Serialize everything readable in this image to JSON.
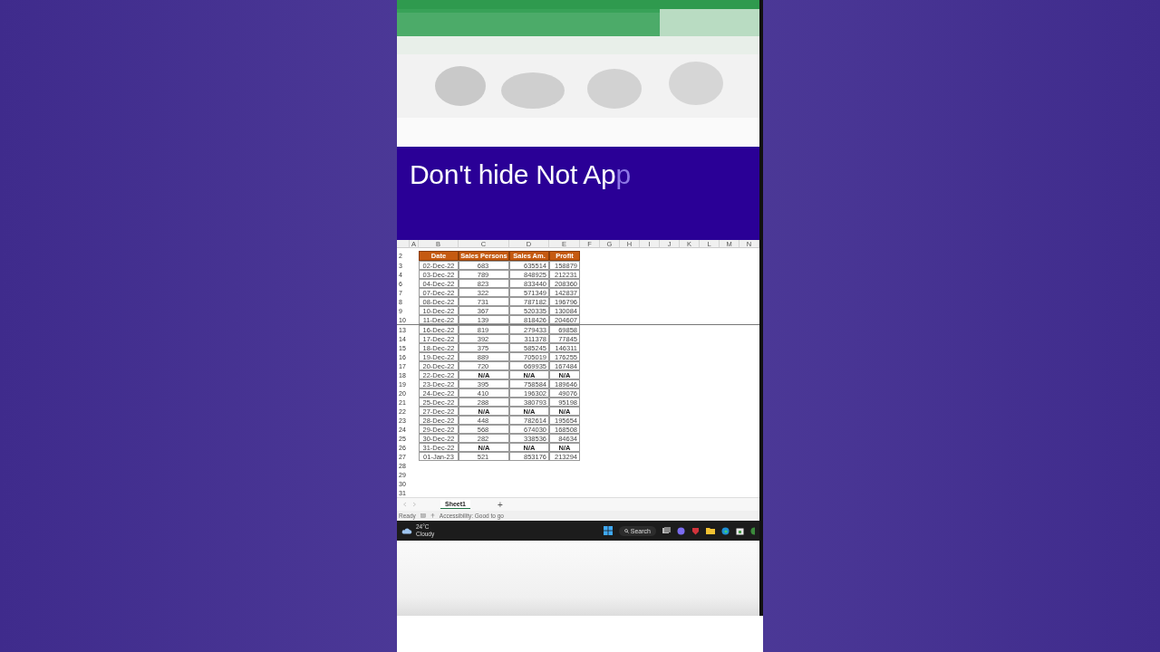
{
  "caption": {
    "text": "Don't hide Not Ap",
    "typing": "p"
  },
  "sheet": {
    "columns": [
      "A",
      "B",
      "C",
      "D",
      "E",
      "F",
      "G",
      "H",
      "I",
      "J",
      "K",
      "L",
      "M",
      "N"
    ],
    "header": {
      "row": "2",
      "cells": [
        "",
        "Date",
        "Sales Persons",
        "Sales Am.",
        "Profit"
      ]
    },
    "rows": [
      {
        "row": "3",
        "missing": false,
        "cells": [
          "",
          "02-Dec-22",
          "683",
          "635514",
          "158879"
        ]
      },
      {
        "row": "4",
        "missing": false,
        "cells": [
          "",
          "03-Dec-22",
          "789",
          "848925",
          "212231"
        ]
      },
      {
        "row": "6",
        "missing": false,
        "cells": [
          "",
          "04-Dec-22",
          "823",
          "833440",
          "208360"
        ]
      },
      {
        "row": "7",
        "missing": false,
        "cells": [
          "",
          "07-Dec-22",
          "322",
          "571349",
          "142837"
        ]
      },
      {
        "row": "8",
        "missing": false,
        "cells": [
          "",
          "08-Dec-22",
          "731",
          "787182",
          "196796"
        ]
      },
      {
        "row": "9",
        "missing": false,
        "cells": [
          "",
          "10-Dec-22",
          "367",
          "520335",
          "130084"
        ]
      },
      {
        "row": "10",
        "missing": false,
        "cells": [
          "",
          "11-Dec-22",
          "139",
          "818426",
          "204607"
        ]
      },
      {
        "row": "13",
        "missing": false,
        "hidden_above": true,
        "cells": [
          "",
          "16-Dec-22",
          "819",
          "279433",
          "69858"
        ]
      },
      {
        "row": "14",
        "missing": false,
        "cells": [
          "",
          "17-Dec-22",
          "392",
          "311378",
          "77845"
        ]
      },
      {
        "row": "15",
        "missing": false,
        "cells": [
          "",
          "18-Dec-22",
          "375",
          "585245",
          "146311"
        ]
      },
      {
        "row": "16",
        "missing": false,
        "cells": [
          "",
          "19-Dec-22",
          "889",
          "705019",
          "176255"
        ]
      },
      {
        "row": "17",
        "missing": false,
        "cells": [
          "",
          "20-Dec-22",
          "720",
          "669935",
          "167484"
        ]
      },
      {
        "row": "18",
        "missing": true,
        "cells": [
          "",
          "22-Dec-22",
          "N/A",
          "N/A",
          "N/A"
        ]
      },
      {
        "row": "19",
        "missing": false,
        "cells": [
          "",
          "23-Dec-22",
          "395",
          "758584",
          "189646"
        ]
      },
      {
        "row": "20",
        "missing": false,
        "cells": [
          "",
          "24-Dec-22",
          "410",
          "196302",
          "49076"
        ]
      },
      {
        "row": "21",
        "missing": false,
        "cells": [
          "",
          "25-Dec-22",
          "288",
          "380793",
          "95198"
        ]
      },
      {
        "row": "22",
        "missing": true,
        "cells": [
          "",
          "27-Dec-22",
          "N/A",
          "N/A",
          "N/A"
        ]
      },
      {
        "row": "23",
        "missing": false,
        "cells": [
          "",
          "28-Dec-22",
          "448",
          "782614",
          "195654"
        ]
      },
      {
        "row": "24",
        "missing": false,
        "cells": [
          "",
          "29-Dec-22",
          "568",
          "674030",
          "168508"
        ]
      },
      {
        "row": "25",
        "missing": false,
        "cells": [
          "",
          "30-Dec-22",
          "282",
          "338536",
          "84634"
        ]
      },
      {
        "row": "26",
        "missing": true,
        "cells": [
          "",
          "31-Dec-22",
          "N/A",
          "N/A",
          "N/A"
        ]
      },
      {
        "row": "27",
        "missing": false,
        "cells": [
          "",
          "01-Jan-23",
          "521",
          "853176",
          "213294"
        ]
      }
    ],
    "empty_rows": [
      "28",
      "29",
      "30",
      "31"
    ],
    "tabs": [
      {
        "label": "Sheet1",
        "selected": true
      }
    ],
    "add_sheet": "+"
  },
  "status_bar": {
    "ready": "Ready",
    "accessibility": "Accessibility: Good to go"
  },
  "taskbar": {
    "temperature": "24°C",
    "weather": "Cloudy",
    "search": "Search"
  }
}
